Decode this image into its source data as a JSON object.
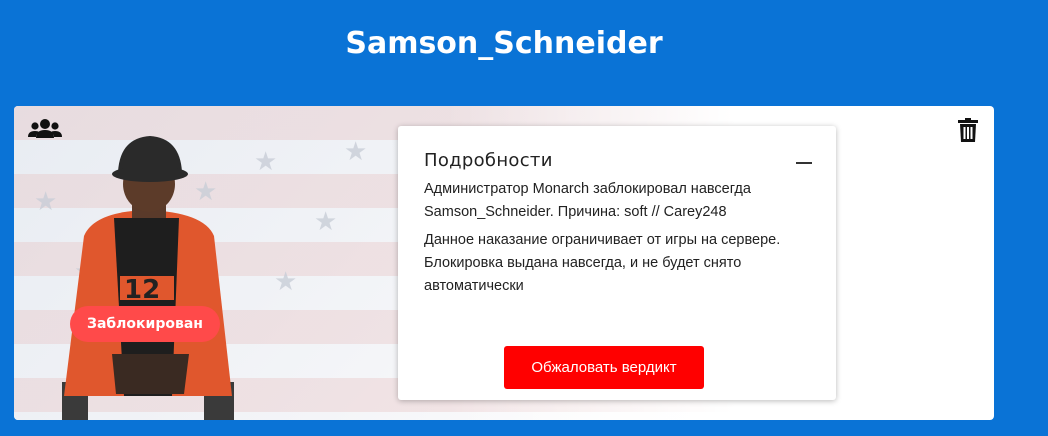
{
  "header": {
    "title": "Samson_Schneider"
  },
  "player": {
    "status": "Заблокирован"
  },
  "details": {
    "title": "Подробности",
    "text_1": "Администратор Monarch заблокировал навсегда Samson_Schneider. Причина: soft // Carey248",
    "text_2": "Данное наказание ограничивает от игры на сервере. Блокировка выдана навсегда, и не будет снято автоматически",
    "appeal_label": "Обжаловать вердикт"
  },
  "icons": [
    "group-icon",
    "trash-icon",
    "collapse-icon"
  ],
  "colors": {
    "background": "#0a73d6",
    "badge": "#ff4a4a",
    "appeal": "#ff0000"
  }
}
